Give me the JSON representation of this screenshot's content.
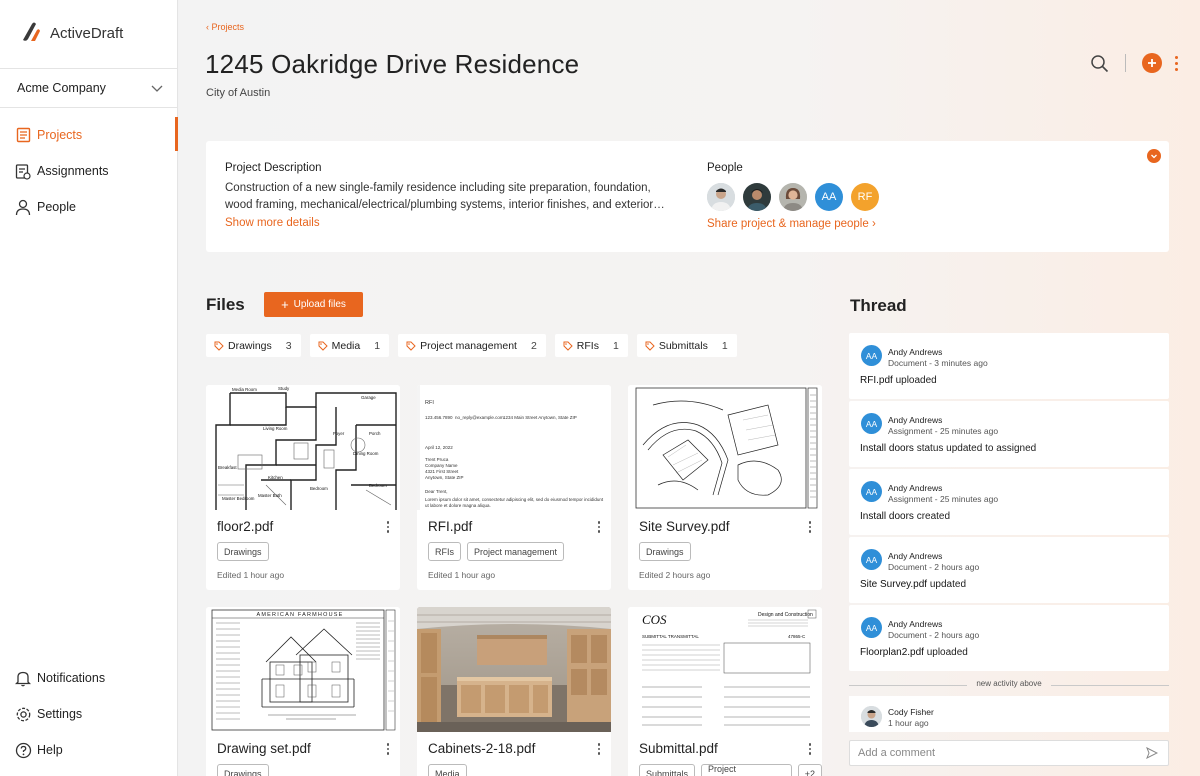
{
  "app": {
    "brand": "ActiveDraft",
    "accent": "#e8661f",
    "avatar_blue": "#2f8fd8"
  },
  "sidebar": {
    "company": "Acme Company",
    "nav": [
      {
        "label": "Projects",
        "icon": "projects-icon"
      },
      {
        "label": "Assignments",
        "icon": "assignments-icon"
      },
      {
        "label": "People",
        "icon": "person-icon"
      }
    ],
    "bottom": [
      {
        "label": "Notifications",
        "icon": "bell-icon"
      },
      {
        "label": "Settings",
        "icon": "gear-icon"
      },
      {
        "label": "Help",
        "icon": "help-icon"
      }
    ]
  },
  "header": {
    "breadcrumb": "‹ Projects",
    "title": "1245 Oakridge Drive Residence",
    "subtitle": "City of Austin"
  },
  "project": {
    "description_label": "Project Description",
    "description": "Construction of a new single-family residence including site preparation, foundation, wood framing, mechanical/electrical/plumbing systems, interior finishes, and exterior…",
    "show_more": "Show more details",
    "people_label": "People",
    "people": [
      {
        "initials": "",
        "type": "photo"
      },
      {
        "initials": "",
        "type": "photo"
      },
      {
        "initials": "",
        "type": "photo"
      },
      {
        "initials": "AA",
        "type": "blue"
      },
      {
        "initials": "RF",
        "type": "orange"
      }
    ],
    "share_link": "Share project & manage people ›"
  },
  "files": {
    "label": "Files",
    "upload_label": "Upload files",
    "categories": [
      {
        "label": "Drawings",
        "count": "3"
      },
      {
        "label": "Media",
        "count": "1"
      },
      {
        "label": "Project management",
        "count": "2"
      },
      {
        "label": "RFIs",
        "count": "1"
      },
      {
        "label": "Submittals",
        "count": "1"
      }
    ],
    "items": [
      {
        "name": "floor2.pdf",
        "tags": [
          "Drawings"
        ],
        "edited": "Edited 1 hour ago"
      },
      {
        "name": "RFI.pdf",
        "tags": [
          "RFIs",
          "Project management"
        ],
        "edited": "Edited 1 hour ago"
      },
      {
        "name": "Site Survey.pdf",
        "tags": [
          "Drawings"
        ],
        "edited": "Edited 2 hours ago"
      },
      {
        "name": "Drawing set.pdf",
        "tags": [
          "Drawings"
        ],
        "edited": ""
      },
      {
        "name": "Cabinets-2-18.pdf",
        "tags": [
          "Media"
        ],
        "edited": ""
      },
      {
        "name": "Submittal.pdf",
        "tags": [
          "Submittals",
          "Project management",
          "+2"
        ],
        "edited": ""
      }
    ],
    "thumb_text": {
      "floor_rooms": [
        "Media Room",
        "Study",
        "Garage",
        "Living Room",
        "Foyer",
        "Porch",
        "Kitchen",
        "Bedroom",
        "Dining Room",
        "Breakfast",
        "Master Bedroom",
        "Master Bath",
        "Bedroom"
      ],
      "rfi": {
        "title": "RFI",
        "contact": "123.456.7890",
        "email": "no_reply@example.com",
        "address": "1234 Main Street  Anytown, State ZIP",
        "date": "April 12, 2022",
        "to": [
          "Trent Pruca",
          "Company Name",
          "4321 First Street",
          "Anytown, State ZIP"
        ],
        "salutation": "Dear Trent,",
        "body": "Lorem ipsum dolor sit amet, consectetur adipiscing elit, sed do eiusmod tempor incididunt ut labore et dolore magna aliqua."
      },
      "drawing_set": "AMERICAN FARMHOUSE",
      "submittal": {
        "logo": "COS",
        "company": "Design and Construction",
        "heading": "SUBMITTAL TRANSMITTAL",
        "project_no": "47865-C"
      }
    }
  },
  "thread": {
    "label": "Thread",
    "events": [
      {
        "initials": "AA",
        "name": "Andy Andrews",
        "meta": "Document - 3 minutes ago",
        "subject": "RFI.pdf",
        "action": " uploaded"
      },
      {
        "initials": "AA",
        "name": "Andy Andrews",
        "meta": "Assignment - 25 minutes ago",
        "subject": "Install doors",
        "action": " status updated to assigned"
      },
      {
        "initials": "AA",
        "name": "Andy Andrews",
        "meta": "Assignment - 25 minutes ago",
        "subject": "Install doors",
        "action": " created"
      },
      {
        "initials": "AA",
        "name": "Andy Andrews",
        "meta": "Document - 2 hours ago",
        "subject": "Site Survey.pdf",
        "action": " updated"
      },
      {
        "initials": "AA",
        "name": "Andy Andrews",
        "meta": "Document - 2 hours ago",
        "subject": "Floorplan2.pdf",
        "action": " uploaded"
      }
    ],
    "new_activity": "new activity above",
    "last": {
      "name": "Cody Fisher",
      "meta": "1 hour ago"
    },
    "comment_placeholder": "Add a comment"
  }
}
